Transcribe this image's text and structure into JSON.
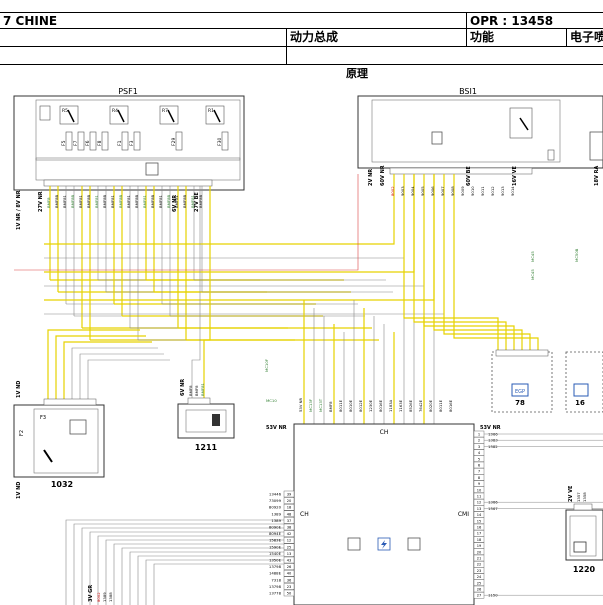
{
  "header": {
    "model": "7 CHINE",
    "opr": "OPR : 13458",
    "category": "动力总成",
    "function_label": "功能",
    "electric_label": "电子喷"
  },
  "diagram": {
    "section_title": "原理",
    "modules": {
      "psf1": "PSF1",
      "bsi1": "BSI1",
      "m1032": "1032",
      "m1211": "1211",
      "m1220": "1220",
      "egr": "EGP",
      "egr_num": "78",
      "m16": "16"
    },
    "ch_box": {
      "top_label": "CH",
      "left_label": "CH",
      "right_label": "CMI",
      "top_connector": "53V NR",
      "right_connector": "53V NR"
    },
    "psf1_fuses": [
      "F5",
      "F7",
      "F6",
      "F8",
      "F1",
      "F3",
      "F29",
      "F30"
    ],
    "psf1_relays": [
      "R5",
      "R4",
      "R7",
      "R1"
    ],
    "psf1_connectors": [
      "1V NR / 8V NR",
      "27V NR",
      "6V NR",
      "27V BE"
    ],
    "psf1_wires": [
      "BMF8",
      "BMF8B",
      "BMF81",
      "BMF8B",
      "BMF81",
      "BMF8B",
      "BMF81",
      "BMF8B",
      "BMF81",
      "BMF8B",
      "BMF81",
      "BMF8B",
      "BMF81",
      "BMF8B",
      "BMF81",
      "BMF8B",
      "BMF81",
      "BMF8B",
      "BMF81",
      "BMF8B"
    ],
    "bsi1_connectors": [
      "2V NR",
      "60V NR",
      "60V BE",
      "16V VE",
      "18V RA"
    ],
    "bsi1_wires": [
      "8002",
      "9003",
      "9004",
      "9005",
      "9006",
      "9007",
      "9008",
      "9009",
      "9010",
      "9011",
      "9012",
      "9013",
      "9014"
    ],
    "m1032_connectors": [
      "1V ND",
      "1V ND"
    ],
    "m1032_fuse": "F2",
    "m1032_fuse2": "F3",
    "m1211_connector": "6V NR",
    "m1211_wires": [
      "BMF8",
      "BMF8",
      "BMF81"
    ],
    "ch_left_pins": [
      {
        "wire": "13446",
        "pin": "39"
      },
      {
        "wire": "73099",
        "pin": "20"
      },
      {
        "wire": "80920",
        "pin": "18"
      },
      {
        "wire": "1389",
        "pin": "48"
      },
      {
        "wire": "1389",
        "pin": "37"
      },
      {
        "wire": "8090E",
        "pin": "38"
      },
      {
        "wire": "8094E",
        "pin": "42"
      },
      {
        "wire": "1583E",
        "pin": "12"
      },
      {
        "wire": "1590E",
        "pin": "25"
      },
      {
        "wire": "1540E",
        "pin": "13"
      },
      {
        "wire": "1350E",
        "pin": "43"
      },
      {
        "wire": "13798",
        "pin": "26"
      },
      {
        "wire": "1488E",
        "pin": "40"
      },
      {
        "wire": "7318",
        "pin": "36"
      },
      {
        "wire": "13798",
        "pin": "23"
      },
      {
        "wire": "13778",
        "pin": "50"
      }
    ],
    "ch_right_pins": [
      {
        "wire": "1366",
        "pin": "1"
      },
      {
        "wire": "1383",
        "pin": "2"
      },
      {
        "wire": "1382",
        "pin": "3"
      },
      {
        "wire": "",
        "pin": "4"
      },
      {
        "wire": "",
        "pin": "5"
      },
      {
        "wire": "",
        "pin": "6"
      },
      {
        "wire": "",
        "pin": "7"
      },
      {
        "wire": "",
        "pin": "8"
      },
      {
        "wire": "",
        "pin": "9"
      },
      {
        "wire": "",
        "pin": "10"
      },
      {
        "wire": "",
        "pin": "11"
      },
      {
        "wire": "1366",
        "pin": "12"
      },
      {
        "wire": "1367",
        "pin": "13"
      },
      {
        "wire": "",
        "pin": "14"
      },
      {
        "wire": "",
        "pin": "15"
      },
      {
        "wire": "",
        "pin": "16"
      },
      {
        "wire": "",
        "pin": "17"
      },
      {
        "wire": "",
        "pin": "18"
      },
      {
        "wire": "",
        "pin": "19"
      },
      {
        "wire": "",
        "pin": "20"
      },
      {
        "wire": "",
        "pin": "21"
      },
      {
        "wire": "",
        "pin": "22"
      },
      {
        "wire": "",
        "pin": "23"
      },
      {
        "wire": "",
        "pin": "24"
      },
      {
        "wire": "",
        "pin": "25"
      },
      {
        "wire": "",
        "pin": "26"
      },
      {
        "wire": "1150",
        "pin": "27"
      }
    ],
    "ch_top_wires": [
      "53V NR",
      "MC13F",
      "MC13T",
      "BMF8",
      "8011E",
      "8010E",
      "8012E",
      "1230E",
      "8016E",
      "1183A",
      "1163E",
      "8526E",
      "7642E",
      "8020E",
      "8011E",
      "8016E"
    ],
    "m1220_connector": "2V VE",
    "m1220_wires": [
      "1357",
      "1358"
    ],
    "bottom_connector": "3V GR",
    "bottom_wires": [
      "8002",
      "1389",
      "1388"
    ],
    "mc_labels": [
      "MC10F",
      "MC10",
      "MC45",
      "MC45",
      "MC50B"
    ]
  }
}
